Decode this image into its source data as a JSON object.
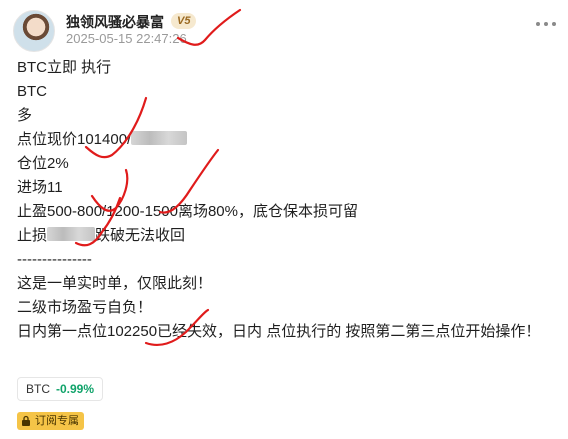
{
  "post": {
    "author": "独领风骚必暴富",
    "level_badge": "V5",
    "timestamp": "2025-05-15 22:47:26",
    "lines": [
      "BTC立即 执行",
      "BTC",
      "多",
      "点位现价101400/",
      "仓位2%",
      "进场11",
      "止盈500-800/1200-1500离场80%，底仓保本损可留",
      "止损",
      "跌破无法收回",
      "---------------",
      "这是一单实时单，仅限此刻！",
      "二级市场盈亏自负！",
      "日内第一点位102250已经失效，日内 点位执行的 按照第二第三点位开始操作！"
    ]
  },
  "stock_tag": {
    "symbol": "BTC",
    "change": "-0.99%"
  },
  "subscription_badge": "订阅专属",
  "colors": {
    "up_green": "#10a36a",
    "scribble_red": "#e01b1b",
    "badge_gold": "#f5c447"
  },
  "icons": [
    "avatar",
    "more-options-icon",
    "lock-icon"
  ]
}
